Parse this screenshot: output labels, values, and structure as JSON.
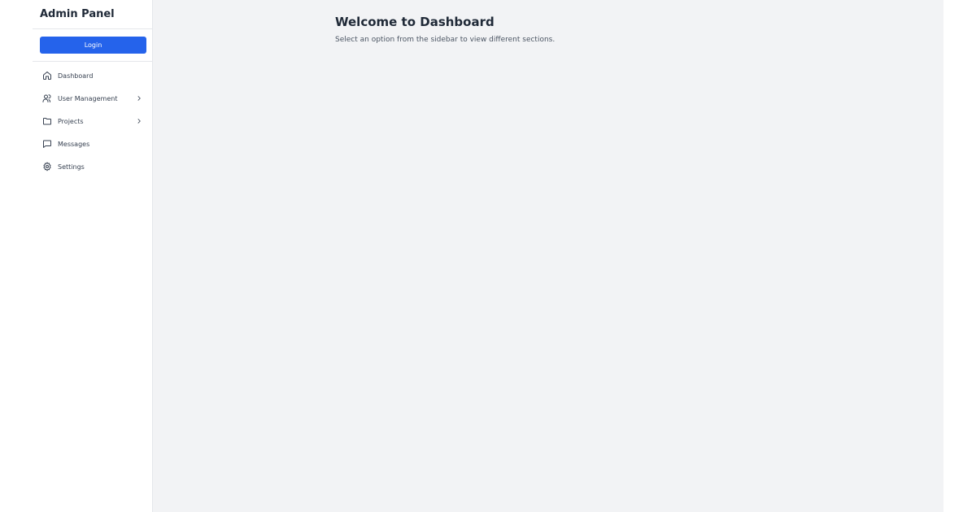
{
  "sidebar": {
    "brand": "Admin Panel",
    "login_label": "Login",
    "items": [
      {
        "label": "Dashboard",
        "icon": "home-icon",
        "has_submenu": false
      },
      {
        "label": "User Management",
        "icon": "users-icon",
        "has_submenu": true
      },
      {
        "label": "Projects",
        "icon": "folder-icon",
        "has_submenu": true
      },
      {
        "label": "Messages",
        "icon": "message-icon",
        "has_submenu": false
      },
      {
        "label": "Settings",
        "icon": "gear-icon",
        "has_submenu": false
      }
    ]
  },
  "main": {
    "title": "Welcome to Dashboard",
    "subtitle": "Select an option from the sidebar to view different sections."
  },
  "colors": {
    "accent": "#2563eb",
    "main_background": "#f2f3f5",
    "text_primary": "#1f2937",
    "text_secondary": "#4b5563"
  }
}
